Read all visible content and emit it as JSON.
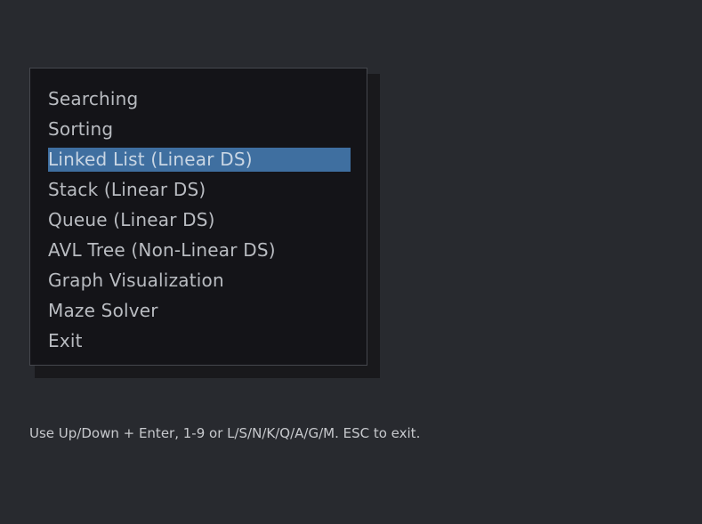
{
  "menu": {
    "items": [
      {
        "label": "Searching",
        "selected": false
      },
      {
        "label": "Sorting",
        "selected": false
      },
      {
        "label": "Linked List (Linear DS)",
        "selected": true
      },
      {
        "label": "Stack (Linear DS)",
        "selected": false
      },
      {
        "label": "Queue (Linear DS)",
        "selected": false
      },
      {
        "label": "AVL Tree (Non-Linear DS)",
        "selected": false
      },
      {
        "label": "Graph Visualization",
        "selected": false
      },
      {
        "label": "Maze Solver",
        "selected": false
      },
      {
        "label": "Exit",
        "selected": false
      }
    ]
  },
  "help": {
    "text": "Use Up/Down + Enter, 1-9 or L/S/N/K/Q/A/G/M. ESC to exit."
  },
  "colors": {
    "background": "#282a2f",
    "panel": "#141418",
    "selection": "#3f6fa0",
    "text": "#b9bcc1"
  }
}
